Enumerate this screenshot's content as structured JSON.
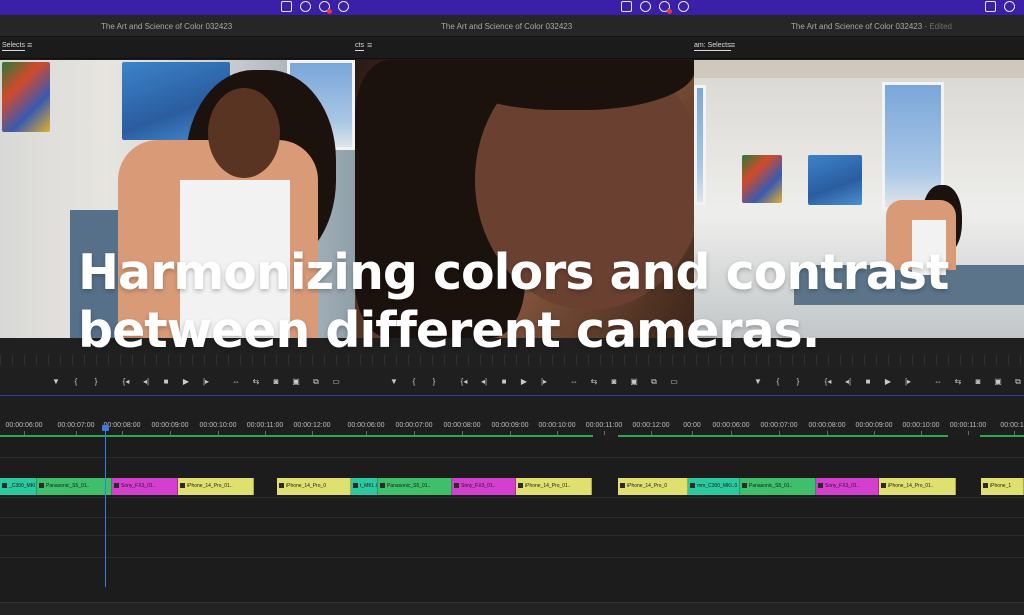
{
  "windows": [
    {
      "title": "The Art and Science of Color 032423",
      "edited": "",
      "panel_label": "Selects"
    },
    {
      "title": "The Art and Science of Color 032423",
      "edited": "",
      "panel_label": "cts"
    },
    {
      "title": "The Art and Science of Color 032423",
      "edited": " - Edited",
      "panel_label": "am: Selects"
    }
  ],
  "panel_menu_icon": "hamburger-menu-icon",
  "overlay": {
    "line1": "Harmonizing colors and contrast",
    "line2": "between different cameras."
  },
  "transport_buttons": [
    "marker-icon",
    "mark-in-icon",
    "mark-out-icon",
    "go-to-in-icon",
    "step-back-icon",
    "stop-icon",
    "play-icon",
    "go-to-out-icon",
    "insert-icon",
    "overwrite-icon",
    "camera-icon",
    "compare-icon",
    "export-frame-icon",
    "settings-icon"
  ],
  "transport_glyphs": [
    "▼",
    "{",
    "}",
    "{◂",
    "◂|",
    "■",
    "▶",
    "|▸",
    "⇔",
    "⇆",
    "◙",
    "▣",
    "⧉",
    "▭"
  ],
  "timeline": {
    "ruler_a": [
      "00:00:06:00",
      "00:00:07:00",
      "00:00:08:00",
      "00:00:09:00",
      "00:00:10:00",
      "00:00:11:00",
      "00:00:12:00"
    ],
    "ruler_b": [
      "00:00:06:00",
      "00:00:07:00",
      "00:00:08:00",
      "00:00:09:00",
      "00:00:10:00",
      "00:00:11:00",
      "00:00:12:00"
    ],
    "ruler_c": [
      "00:00",
      "00:00:06:00",
      "00:00:07:00",
      "00:00:08:00",
      "00:00:09:00",
      "00:00:10:00",
      "00:00:11:00",
      "00:00:12"
    ],
    "clips": [
      {
        "label": "_C300_MKI..0",
        "color": "teal"
      },
      {
        "label": "Panasonic_S5_01..",
        "color": "green"
      },
      {
        "label": "Sony_FX3_01..",
        "color": "magenta"
      },
      {
        "label": "iPhone_14_Pro_01..",
        "color": "yellow"
      },
      {
        "label": "iPhone_14_Pro_0",
        "color": "yellow"
      },
      {
        "label": "t_MKI..0",
        "color": "teal"
      },
      {
        "label": "Panasonic_S5_01..",
        "color": "green"
      },
      {
        "label": "Sony_FX3_01..",
        "color": "magenta"
      },
      {
        "label": "iPhone_14_Pro_01..",
        "color": "yellow"
      },
      {
        "label": "iPhone_14_Pro_0",
        "color": "yellow"
      },
      {
        "label": "mm_C300_MKI..0",
        "color": "teal"
      },
      {
        "label": "Panasonic_S5_01..",
        "color": "green"
      },
      {
        "label": "Sony_FX3_01..",
        "color": "magenta"
      },
      {
        "label": "iPhone_14_Pro_01..",
        "color": "yellow"
      },
      {
        "label": "iPhone_1",
        "color": "yellow"
      }
    ]
  },
  "colors": {
    "top_bar": "#3a1fa8",
    "playhead": "#3e7be0",
    "in_out_bar": "#2fa84a"
  }
}
